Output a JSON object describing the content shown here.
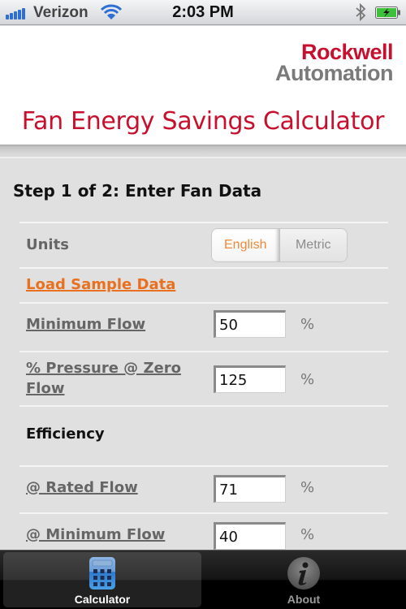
{
  "status_bar": {
    "carrier": "Verizon",
    "time": "2:03 PM",
    "signal_bars": 5,
    "battery_charging": true
  },
  "header": {
    "logo_line1": "Rockwell",
    "logo_line2": "Automation",
    "app_title": "Fan Energy Savings Calculator"
  },
  "colors": {
    "brand_red": "#c8102e",
    "accent_orange": "#e8701e",
    "logo_gray": "#7a7a7a"
  },
  "form": {
    "step_title": "Step 1 of 2: Enter Fan Data",
    "units": {
      "label": "Units",
      "options": [
        "English",
        "Metric"
      ],
      "selected": "English"
    },
    "load_sample_label": "Load Sample Data",
    "minimum_flow": {
      "label": "Minimum Flow",
      "value": "50",
      "unit": "%"
    },
    "pressure_zero_flow": {
      "label_line1": "% Pressure @ Zero",
      "label_line2": "Flow",
      "value": "125",
      "unit": "%"
    },
    "efficiency_heading": "Efficiency",
    "rated_flow_eff": {
      "label": "@ Rated Flow",
      "value": "71",
      "unit": "%"
    },
    "min_flow_eff": {
      "label": "@ Minimum Flow",
      "value": "40",
      "unit": "%"
    }
  },
  "tabbar": {
    "tabs": [
      {
        "label": "Calculator",
        "icon": "calculator-icon",
        "active": true
      },
      {
        "label": "About",
        "icon": "info-icon",
        "active": false
      }
    ]
  }
}
